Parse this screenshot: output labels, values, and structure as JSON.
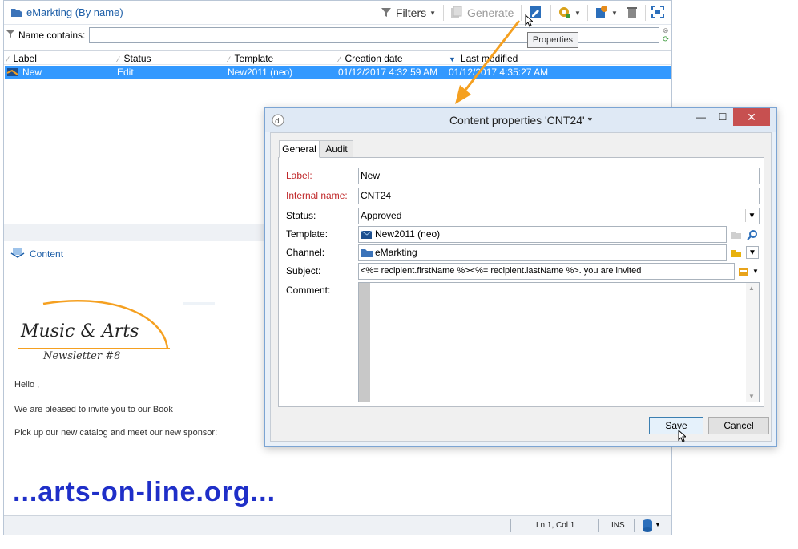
{
  "app": {
    "title": "eMarkting (By name)",
    "toolbar": {
      "filters_label": "Filters",
      "generate_label": "Generate"
    }
  },
  "filter": {
    "label": "Name contains:",
    "value": ""
  },
  "list": {
    "columns": [
      "Label",
      "Status",
      "Template",
      "Creation date",
      "Last modified"
    ],
    "rows": [
      {
        "label": "New",
        "status": "Edit",
        "template": "New2011 (neo)",
        "creation_date": "01/12/2017 4:32:59 AM",
        "last_modified": "01/12/2017 4:35:27 AM"
      }
    ]
  },
  "content_panel": {
    "label": "Content",
    "preview": {
      "logo_line1": "Music & Arts",
      "logo_line2": "Newsletter #8",
      "greeting": "Hello ,",
      "line1": "We are pleased to invite you to our Book",
      "line2": "Pick up our new catalog and meet our new sponsor:",
      "banner": "...arts-on-line.org..."
    }
  },
  "statusbar": {
    "position": "Ln 1, Col 1",
    "mode": "INS"
  },
  "tooltip": {
    "text": "Properties"
  },
  "dialog": {
    "title": "Content properties 'CNT24' *",
    "tabs": [
      "General",
      "Audit"
    ],
    "fields": {
      "label": {
        "caption": "Label:",
        "value": "New"
      },
      "internal_name": {
        "caption": "Internal name:",
        "value": "CNT24"
      },
      "status": {
        "caption": "Status:",
        "value": "Approved"
      },
      "template": {
        "caption": "Template:",
        "value": "New2011 (neo)"
      },
      "channel": {
        "caption": "Channel:",
        "value": "eMarkting"
      },
      "subject": {
        "caption": "Subject:",
        "value": "<%= recipient.firstName %><%= recipient.lastName %>. you are invited"
      },
      "comment": {
        "caption": "Comment:",
        "value": ""
      }
    },
    "buttons": {
      "save": "Save",
      "cancel": "Cancel"
    }
  },
  "colors": {
    "selection": "#3399ff",
    "accent_orange": "#f5a020",
    "banner_blue": "#1f2fc8",
    "required_red": "#c0282a",
    "close_red": "#c75050"
  }
}
